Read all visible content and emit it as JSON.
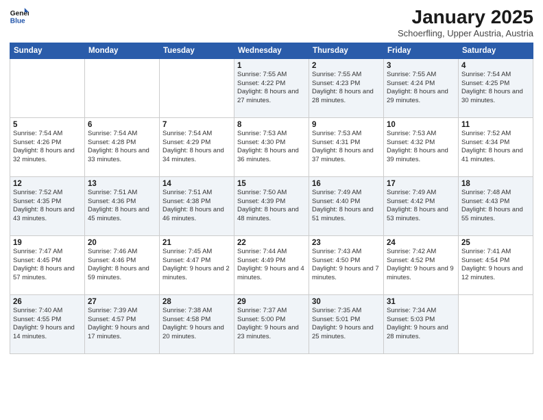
{
  "header": {
    "logo_line1": "General",
    "logo_line2": "Blue",
    "month": "January 2025",
    "location": "Schoerfling, Upper Austria, Austria"
  },
  "weekdays": [
    "Sunday",
    "Monday",
    "Tuesday",
    "Wednesday",
    "Thursday",
    "Friday",
    "Saturday"
  ],
  "weeks": [
    [
      {
        "num": "",
        "info": ""
      },
      {
        "num": "",
        "info": ""
      },
      {
        "num": "",
        "info": ""
      },
      {
        "num": "1",
        "info": "Sunrise: 7:55 AM\nSunset: 4:22 PM\nDaylight: 8 hours and 27 minutes."
      },
      {
        "num": "2",
        "info": "Sunrise: 7:55 AM\nSunset: 4:23 PM\nDaylight: 8 hours and 28 minutes."
      },
      {
        "num": "3",
        "info": "Sunrise: 7:55 AM\nSunset: 4:24 PM\nDaylight: 8 hours and 29 minutes."
      },
      {
        "num": "4",
        "info": "Sunrise: 7:54 AM\nSunset: 4:25 PM\nDaylight: 8 hours and 30 minutes."
      }
    ],
    [
      {
        "num": "5",
        "info": "Sunrise: 7:54 AM\nSunset: 4:26 PM\nDaylight: 8 hours and 32 minutes."
      },
      {
        "num": "6",
        "info": "Sunrise: 7:54 AM\nSunset: 4:28 PM\nDaylight: 8 hours and 33 minutes."
      },
      {
        "num": "7",
        "info": "Sunrise: 7:54 AM\nSunset: 4:29 PM\nDaylight: 8 hours and 34 minutes."
      },
      {
        "num": "8",
        "info": "Sunrise: 7:53 AM\nSunset: 4:30 PM\nDaylight: 8 hours and 36 minutes."
      },
      {
        "num": "9",
        "info": "Sunrise: 7:53 AM\nSunset: 4:31 PM\nDaylight: 8 hours and 37 minutes."
      },
      {
        "num": "10",
        "info": "Sunrise: 7:53 AM\nSunset: 4:32 PM\nDaylight: 8 hours and 39 minutes."
      },
      {
        "num": "11",
        "info": "Sunrise: 7:52 AM\nSunset: 4:34 PM\nDaylight: 8 hours and 41 minutes."
      }
    ],
    [
      {
        "num": "12",
        "info": "Sunrise: 7:52 AM\nSunset: 4:35 PM\nDaylight: 8 hours and 43 minutes."
      },
      {
        "num": "13",
        "info": "Sunrise: 7:51 AM\nSunset: 4:36 PM\nDaylight: 8 hours and 45 minutes."
      },
      {
        "num": "14",
        "info": "Sunrise: 7:51 AM\nSunset: 4:38 PM\nDaylight: 8 hours and 46 minutes."
      },
      {
        "num": "15",
        "info": "Sunrise: 7:50 AM\nSunset: 4:39 PM\nDaylight: 8 hours and 48 minutes."
      },
      {
        "num": "16",
        "info": "Sunrise: 7:49 AM\nSunset: 4:40 PM\nDaylight: 8 hours and 51 minutes."
      },
      {
        "num": "17",
        "info": "Sunrise: 7:49 AM\nSunset: 4:42 PM\nDaylight: 8 hours and 53 minutes."
      },
      {
        "num": "18",
        "info": "Sunrise: 7:48 AM\nSunset: 4:43 PM\nDaylight: 8 hours and 55 minutes."
      }
    ],
    [
      {
        "num": "19",
        "info": "Sunrise: 7:47 AM\nSunset: 4:45 PM\nDaylight: 8 hours and 57 minutes."
      },
      {
        "num": "20",
        "info": "Sunrise: 7:46 AM\nSunset: 4:46 PM\nDaylight: 8 hours and 59 minutes."
      },
      {
        "num": "21",
        "info": "Sunrise: 7:45 AM\nSunset: 4:47 PM\nDaylight: 9 hours and 2 minutes."
      },
      {
        "num": "22",
        "info": "Sunrise: 7:44 AM\nSunset: 4:49 PM\nDaylight: 9 hours and 4 minutes."
      },
      {
        "num": "23",
        "info": "Sunrise: 7:43 AM\nSunset: 4:50 PM\nDaylight: 9 hours and 7 minutes."
      },
      {
        "num": "24",
        "info": "Sunrise: 7:42 AM\nSunset: 4:52 PM\nDaylight: 9 hours and 9 minutes."
      },
      {
        "num": "25",
        "info": "Sunrise: 7:41 AM\nSunset: 4:54 PM\nDaylight: 9 hours and 12 minutes."
      }
    ],
    [
      {
        "num": "26",
        "info": "Sunrise: 7:40 AM\nSunset: 4:55 PM\nDaylight: 9 hours and 14 minutes."
      },
      {
        "num": "27",
        "info": "Sunrise: 7:39 AM\nSunset: 4:57 PM\nDaylight: 9 hours and 17 minutes."
      },
      {
        "num": "28",
        "info": "Sunrise: 7:38 AM\nSunset: 4:58 PM\nDaylight: 9 hours and 20 minutes."
      },
      {
        "num": "29",
        "info": "Sunrise: 7:37 AM\nSunset: 5:00 PM\nDaylight: 9 hours and 23 minutes."
      },
      {
        "num": "30",
        "info": "Sunrise: 7:35 AM\nSunset: 5:01 PM\nDaylight: 9 hours and 25 minutes."
      },
      {
        "num": "31",
        "info": "Sunrise: 7:34 AM\nSunset: 5:03 PM\nDaylight: 9 hours and 28 minutes."
      },
      {
        "num": "",
        "info": ""
      }
    ]
  ]
}
